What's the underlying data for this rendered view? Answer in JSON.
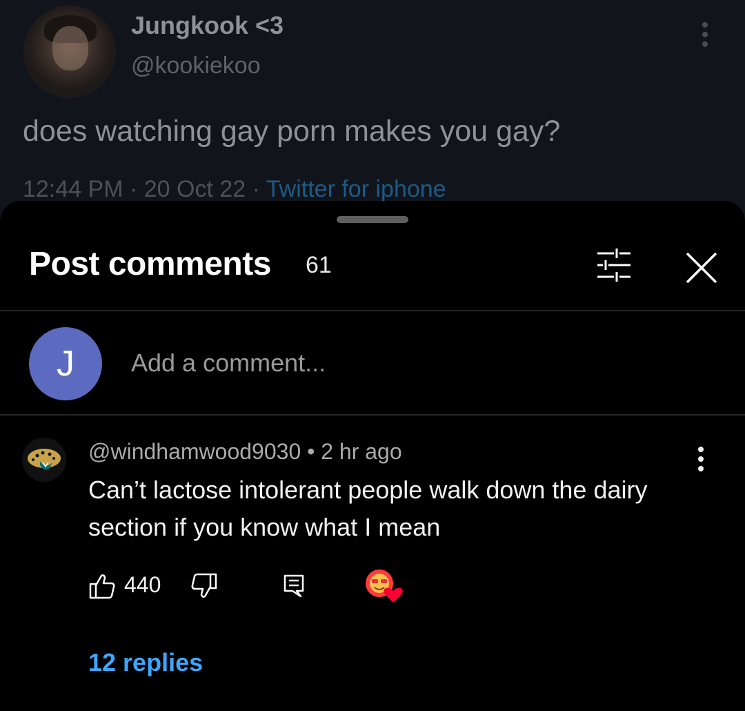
{
  "tweet": {
    "name": "Jungkook <3",
    "handle": "@kookiekoo",
    "text": "does watching gay porn makes you gay?",
    "meta_time": "12:44 PM · 20 Oct 22 · ",
    "meta_source": "Twitter for iphone"
  },
  "comments_panel": {
    "title": "Post comments",
    "count": "61",
    "user_initial": "J",
    "add_comment_placeholder": "Add a comment..."
  },
  "comment": {
    "author": "@windhamwood9030",
    "separator": " • ",
    "time": "2 hr ago",
    "text": "Can’t lactose intolerant people walk down the dairy section if you know what I mean",
    "likes": "440",
    "replies_label": "12 replies"
  },
  "colors": {
    "accent_link": "#3ea6ff",
    "avatar_bg": "#5c6bc0",
    "heart": "#ff0033"
  },
  "icons": [
    "more-vert-icon",
    "filter-icon",
    "close-icon",
    "thumb-up-icon",
    "thumb-down-icon",
    "comment-icon",
    "creator-heart-icon"
  ]
}
